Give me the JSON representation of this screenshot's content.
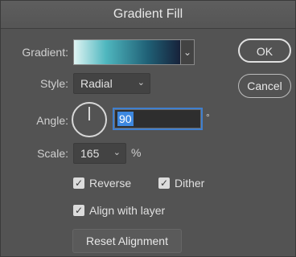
{
  "dialog": {
    "title": "Gradient Fill"
  },
  "gradient": {
    "label": "Gradient:",
    "chevron": "⌄"
  },
  "style": {
    "label": "Style:",
    "value": "Radial",
    "chevron": "⌄"
  },
  "angle": {
    "label": "Angle:",
    "value": "90",
    "unit": "°",
    "dial_degrees": 90
  },
  "scale": {
    "label": "Scale:",
    "value": "165",
    "unit": "%",
    "chevron": "⌄"
  },
  "options": {
    "reverse": {
      "label": "Reverse",
      "checked": true
    },
    "dither": {
      "label": "Dither",
      "checked": true
    },
    "align_with_layer": {
      "label": "Align with layer",
      "checked": true
    }
  },
  "buttons": {
    "ok": "OK",
    "cancel": "Cancel",
    "reset_alignment": "Reset Alignment"
  },
  "check_glyph": "✓",
  "colors": {
    "dialog_bg": "#535353",
    "gradient_stops": [
      "#dff4f3",
      "#4fb7bf",
      "#1f5f75",
      "#17223a"
    ],
    "selection_highlight": "#3d88e0"
  }
}
